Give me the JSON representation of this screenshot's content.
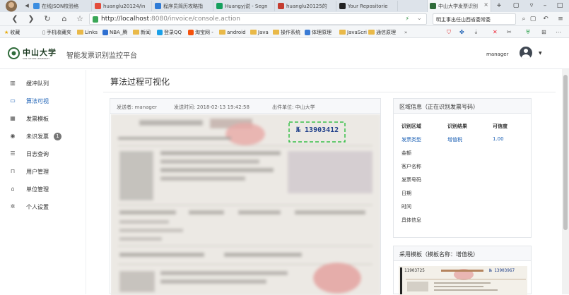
{
  "browser": {
    "tabs": [
      {
        "label": "在线JSON校验格",
        "fav_color": "#3b8de0"
      },
      {
        "label": "huanglu20124/in",
        "fav_color": "#e34c3b"
      },
      {
        "label": "程序员简历攻略指",
        "fav_color": "#2d7ad6"
      },
      {
        "label": "Huangyj说 - Segn",
        "fav_color": "#16a05d"
      },
      {
        "label": "huanglu20125的",
        "fav_color": "#c43c2f"
      },
      {
        "label": "Your Repositorie",
        "fav_color": "#222222"
      },
      {
        "label": "中山大学发票识别",
        "fav_color": "#2f6b3a"
      }
    ],
    "url_host": "http://localhost",
    "url_path": ":8080/invoice/console.action",
    "search_text": "明主事出任山西省委常委",
    "bookmarks": [
      {
        "label": "收藏",
        "type": "star"
      },
      {
        "label": "手机收藏夹",
        "type": "folder"
      },
      {
        "label": "Links",
        "type": "folder"
      },
      {
        "label": "NBA_腾",
        "type": "icon",
        "color": "#2e6fd1"
      },
      {
        "label": "新闻",
        "type": "folder"
      },
      {
        "label": "登录QQ",
        "type": "icon",
        "color": "#1aa0e8"
      },
      {
        "label": "淘宝网 -",
        "type": "icon",
        "color": "#f5520c"
      },
      {
        "label": "android",
        "type": "folder"
      },
      {
        "label": "Java",
        "type": "folder"
      },
      {
        "label": "操作系统",
        "type": "folder"
      },
      {
        "label": "体理原理",
        "type": "icon",
        "color": "#3a7bd5"
      },
      {
        "label": "JavaScri",
        "type": "folder"
      },
      {
        "label": "通信原理",
        "type": "folder"
      }
    ],
    "more_chevron": "»"
  },
  "app": {
    "logo_text": "中山大学",
    "logo_sub": "SUN YAT-SEN UNIVERSITY",
    "system_title": "智能发票识别监控平台",
    "username": "manager"
  },
  "sidebar": {
    "items": [
      {
        "label": "缓冲队列",
        "icon": "chart-icon",
        "glyph": "▥"
      },
      {
        "label": "算法可视",
        "icon": "monitor-icon",
        "glyph": "▭",
        "active": true
      },
      {
        "label": "发票模板",
        "icon": "grid-icon",
        "glyph": "▦"
      },
      {
        "label": "未识发票",
        "icon": "target-icon",
        "glyph": "◉",
        "badge": "1"
      },
      {
        "label": "日志查询",
        "icon": "list-icon",
        "glyph": "☰"
      },
      {
        "label": "用户管理",
        "icon": "lock-icon",
        "glyph": "⊓"
      },
      {
        "label": "单位管理",
        "icon": "bank-icon",
        "glyph": "⌂"
      },
      {
        "label": "个人设置",
        "icon": "gear-icon",
        "glyph": "✲"
      }
    ]
  },
  "main": {
    "page_title": "算法过程可视化",
    "meta": {
      "sender": "发送者: manager",
      "time": "发送时间: 2018-02-13 19:42:58",
      "unit": "出件单位: 中山大学"
    },
    "invoice_number": "№ 13903412"
  },
  "region_panel": {
    "title": "区域信息（正在识别发票号码）",
    "headers": [
      "识别区域",
      "识别结果",
      "可信度"
    ],
    "first_row": {
      "area": "发票类型",
      "result": "增值税",
      "confidence": "1.00"
    },
    "rows": [
      "金额",
      "客户名称",
      "发票号码",
      "日期",
      "时间",
      "具体信息"
    ]
  },
  "template_panel": {
    "title": "采用模板（模板名称：增值税）",
    "thumb_number": "11903725",
    "thumb_stamp": "№ 13903967"
  }
}
